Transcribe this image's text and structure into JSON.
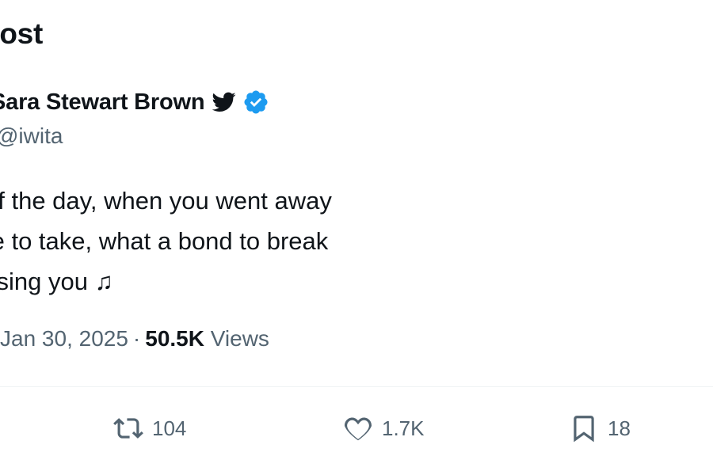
{
  "header": {
    "title": "Post"
  },
  "post": {
    "author": {
      "display_name": "Sara Stewart Brown",
      "handle": "@iwita",
      "badges": [
        "bird-icon",
        "verified-icon"
      ],
      "verified_color": "#1d9bf0"
    },
    "text_lines": [
      "of the day, when you went away",
      "fe to take, what a bond to break",
      "ssing you ♫"
    ],
    "timestamp": "Jan 30, 2025",
    "separator": "·",
    "views_count": "50.5K",
    "views_label": "Views"
  },
  "actions": {
    "reposts": "104",
    "likes": "1.7K",
    "bookmarks": "18"
  },
  "colors": {
    "text": "#0f1419",
    "secondary": "#536471",
    "divider": "#eff3f4",
    "accent": "#1d9bf0"
  }
}
